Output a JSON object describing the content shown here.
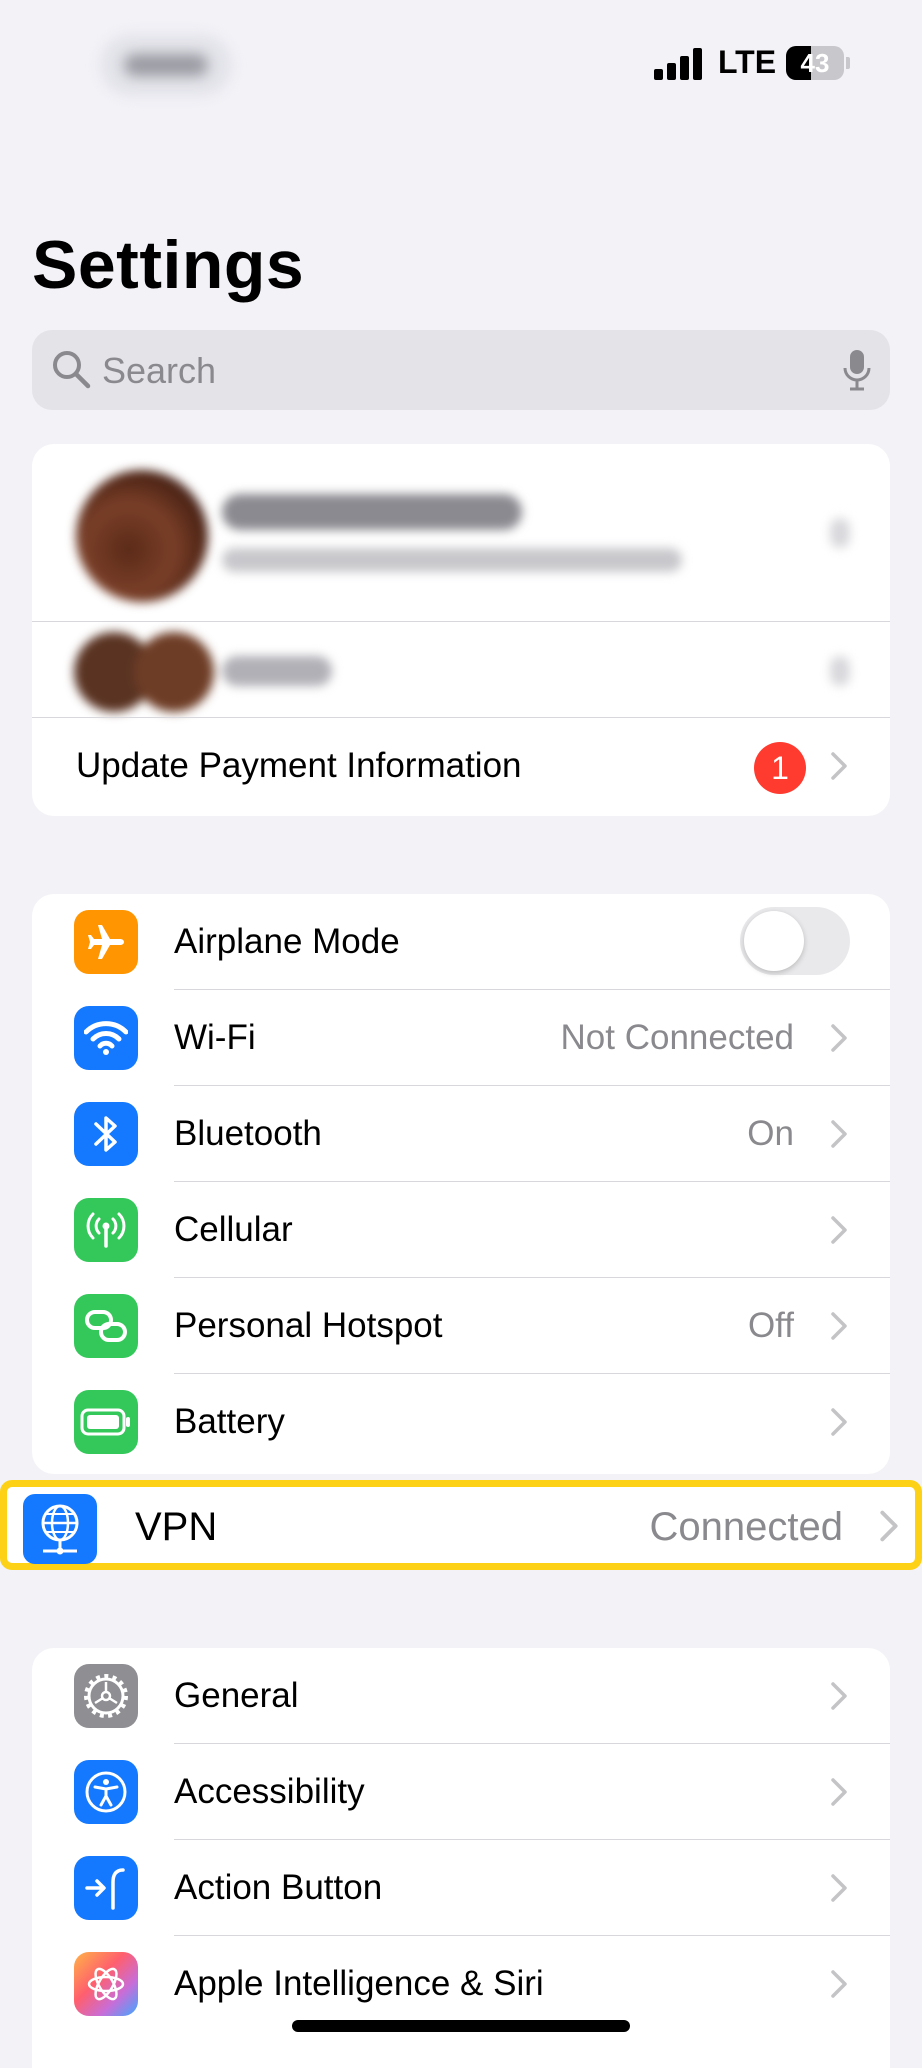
{
  "status_bar": {
    "network": "LTE",
    "battery": "43",
    "battery_level": 0.43
  },
  "page": {
    "title": "Settings"
  },
  "search": {
    "placeholder": "Search"
  },
  "account": {
    "update_payment_label": "Update Payment Information",
    "update_payment_badge": "1"
  },
  "connectivity": {
    "airplane": {
      "label": "Airplane Mode",
      "toggle_on": false
    },
    "wifi": {
      "label": "Wi-Fi",
      "value": "Not Connected"
    },
    "bluetooth": {
      "label": "Bluetooth",
      "value": "On"
    },
    "cellular": {
      "label": "Cellular"
    },
    "hotspot": {
      "label": "Personal Hotspot",
      "value": "Off"
    },
    "battery": {
      "label": "Battery"
    },
    "vpn": {
      "label": "VPN",
      "value": "Connected"
    }
  },
  "general_section": {
    "general": {
      "label": "General"
    },
    "accessibility": {
      "label": "Accessibility"
    },
    "action_button": {
      "label": "Action Button"
    },
    "apple_intelligence": {
      "label": "Apple Intelligence & Siri"
    }
  },
  "colors": {
    "orange": "#ff9500",
    "blue": "#1479fe",
    "green": "#34c759",
    "gray": "#8e8e93",
    "red": "#ff3b30",
    "highlight": "#fcd116"
  }
}
